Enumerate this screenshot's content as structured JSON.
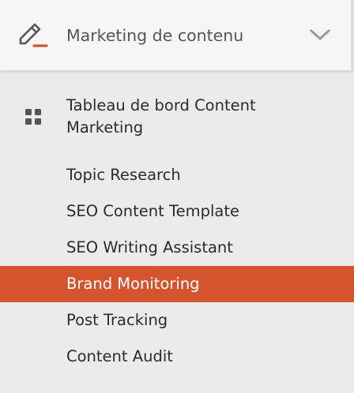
{
  "colors": {
    "accent": "#d4542e",
    "background": "#ebebeb",
    "header_background": "#f6f6f6",
    "text": "#2b2b2b",
    "header_text": "#555555"
  },
  "header": {
    "icon": "pencil-icon",
    "title": "Marketing de contenu",
    "toggle_icon": "chevron-down-icon"
  },
  "submenu": {
    "dashboard": {
      "icon": "grid-icon",
      "label": "Tableau de bord Content Marketing"
    },
    "items": [
      {
        "label": "Topic Research",
        "active": false
      },
      {
        "label": "SEO Content Template",
        "active": false
      },
      {
        "label": "SEO Writing Assistant",
        "active": false
      },
      {
        "label": "Brand Monitoring",
        "active": true
      },
      {
        "label": "Post Tracking",
        "active": false
      },
      {
        "label": "Content Audit",
        "active": false
      }
    ]
  }
}
